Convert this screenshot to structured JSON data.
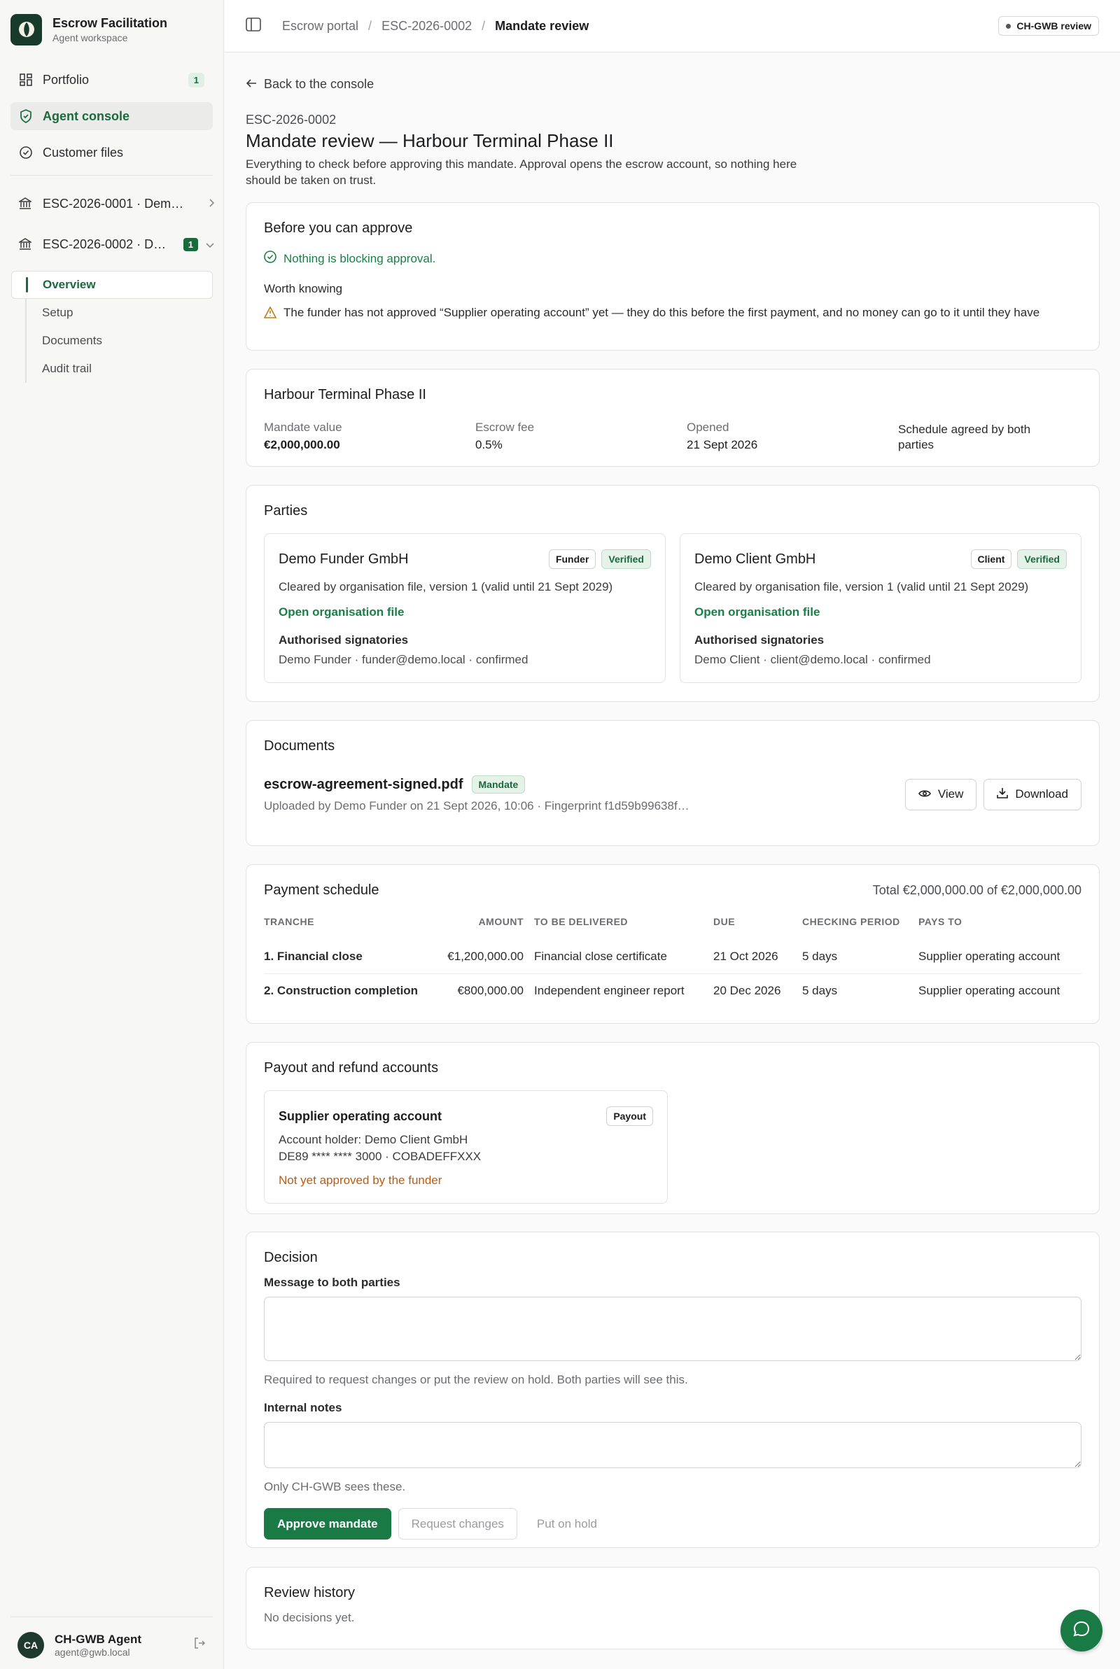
{
  "brand": {
    "title": "Escrow Facilitation",
    "subtitle": "Agent workspace"
  },
  "sidebar": {
    "nav": [
      {
        "label": "Portfolio",
        "icon": "grid-icon",
        "count": "1"
      },
      {
        "label": "Agent console",
        "icon": "shield-check-icon",
        "active": true
      },
      {
        "label": "Customer files",
        "icon": "check-circle-icon"
      }
    ],
    "mandates": [
      {
        "label": "ESC-2026-0001 · Dem…",
        "icon": "bank-icon"
      },
      {
        "label": "ESC-2026-0002 · D…",
        "icon": "bank-icon",
        "count": "1",
        "expanded": true
      }
    ],
    "subnav": [
      "Overview",
      "Setup",
      "Documents",
      "Audit trail"
    ],
    "user": {
      "initials": "CA",
      "name": "CH-GWB Agent",
      "email": "agent@gwb.local"
    }
  },
  "topbar": {
    "breadcrumbs": [
      "Escrow portal",
      "ESC-2026-0002",
      "Mandate review"
    ],
    "env_badge": "CH-GWB review"
  },
  "page": {
    "back": "Back to the console",
    "ref": "ESC-2026-0002",
    "title": "Mandate review — Harbour Terminal Phase II",
    "lede": "Everything to check before approving this mandate. Approval opens the escrow account, so nothing here should be taken on trust."
  },
  "approve": {
    "title": "Before you can approve",
    "ok": "Nothing is blocking approval.",
    "worth_title": "Worth knowing",
    "warning": "The funder has not approved “Supplier operating account” yet — they do this before the first payment, and no money can go to it until they have"
  },
  "summary": {
    "title": "Harbour Terminal Phase II",
    "value_label": "Mandate value",
    "value": "€2,000,000.00",
    "fee_label": "Escrow fee",
    "fee": "0.5%",
    "opened_label": "Opened",
    "opened": "21 Sept 2026",
    "note": "Schedule agreed by both parties"
  },
  "parties": {
    "title": "Parties",
    "items": [
      {
        "name": "Demo Funder GmbH",
        "role": "Funder",
        "status": "Verified",
        "cleared": "Cleared by organisation file, version 1 (valid until 21 Sept 2029)",
        "link": "Open organisation file",
        "sig_title": "Authorised signatories",
        "sig": "Demo Funder · funder@demo.local · confirmed"
      },
      {
        "name": "Demo Client GmbH",
        "role": "Client",
        "status": "Verified",
        "cleared": "Cleared by organisation file, version 1 (valid until 21 Sept 2029)",
        "link": "Open organisation file",
        "sig_title": "Authorised signatories",
        "sig": "Demo Client · client@demo.local · confirmed"
      }
    ]
  },
  "documents": {
    "title": "Documents",
    "name": "escrow-agreement-signed.pdf",
    "tag": "Mandate",
    "meta": "Uploaded by Demo Funder on 21 Sept 2026, 10:06 · Fingerprint f1d59b99638f…",
    "view": "View",
    "download": "Download"
  },
  "schedule": {
    "title": "Payment schedule",
    "total": "Total €2,000,000.00 of €2,000,000.00",
    "columns": [
      "TRANCHE",
      "AMOUNT",
      "TO BE DELIVERED",
      "DUE",
      "CHECKING PERIOD",
      "PAYS TO"
    ],
    "rows": [
      [
        "1. Financial close",
        "€1,200,000.00",
        "Financial close certificate",
        "21 Oct 2026",
        "5 days",
        "Supplier operating account"
      ],
      [
        "2. Construction completion",
        "€800,000.00",
        "Independent engineer report",
        "20 Dec 2026",
        "5 days",
        "Supplier operating account"
      ]
    ]
  },
  "accounts": {
    "title": "Payout and refund accounts",
    "name": "Supplier operating account",
    "tag": "Payout",
    "holder": "Account holder: Demo Client GmbH",
    "iban": "DE89 **** **** 3000 · COBADEFFXXX",
    "status": "Not yet approved by the funder"
  },
  "decision": {
    "title": "Decision",
    "message_label": "Message to both parties",
    "message_hint": "Required to request changes or put the review on hold. Both parties will see this.",
    "notes_label": "Internal notes",
    "notes_hint": "Only CH-GWB sees these.",
    "approve": "Approve mandate",
    "request": "Request changes",
    "hold": "Put on hold"
  },
  "history": {
    "title": "Review history",
    "empty": "No decisions yet."
  },
  "colors": {
    "accent": "#1a7a45",
    "warning": "#c57b16"
  }
}
